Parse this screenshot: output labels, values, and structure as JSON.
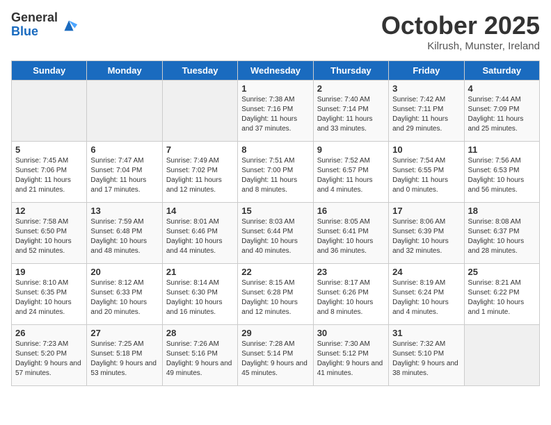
{
  "header": {
    "logo_general": "General",
    "logo_blue": "Blue",
    "month": "October 2025",
    "location": "Kilrush, Munster, Ireland"
  },
  "days_of_week": [
    "Sunday",
    "Monday",
    "Tuesday",
    "Wednesday",
    "Thursday",
    "Friday",
    "Saturday"
  ],
  "weeks": [
    [
      {
        "day": "",
        "info": ""
      },
      {
        "day": "",
        "info": ""
      },
      {
        "day": "",
        "info": ""
      },
      {
        "day": "1",
        "info": "Sunrise: 7:38 AM\nSunset: 7:16 PM\nDaylight: 11 hours and 37 minutes."
      },
      {
        "day": "2",
        "info": "Sunrise: 7:40 AM\nSunset: 7:14 PM\nDaylight: 11 hours and 33 minutes."
      },
      {
        "day": "3",
        "info": "Sunrise: 7:42 AM\nSunset: 7:11 PM\nDaylight: 11 hours and 29 minutes."
      },
      {
        "day": "4",
        "info": "Sunrise: 7:44 AM\nSunset: 7:09 PM\nDaylight: 11 hours and 25 minutes."
      }
    ],
    [
      {
        "day": "5",
        "info": "Sunrise: 7:45 AM\nSunset: 7:06 PM\nDaylight: 11 hours and 21 minutes."
      },
      {
        "day": "6",
        "info": "Sunrise: 7:47 AM\nSunset: 7:04 PM\nDaylight: 11 hours and 17 minutes."
      },
      {
        "day": "7",
        "info": "Sunrise: 7:49 AM\nSunset: 7:02 PM\nDaylight: 11 hours and 12 minutes."
      },
      {
        "day": "8",
        "info": "Sunrise: 7:51 AM\nSunset: 7:00 PM\nDaylight: 11 hours and 8 minutes."
      },
      {
        "day": "9",
        "info": "Sunrise: 7:52 AM\nSunset: 6:57 PM\nDaylight: 11 hours and 4 minutes."
      },
      {
        "day": "10",
        "info": "Sunrise: 7:54 AM\nSunset: 6:55 PM\nDaylight: 11 hours and 0 minutes."
      },
      {
        "day": "11",
        "info": "Sunrise: 7:56 AM\nSunset: 6:53 PM\nDaylight: 10 hours and 56 minutes."
      }
    ],
    [
      {
        "day": "12",
        "info": "Sunrise: 7:58 AM\nSunset: 6:50 PM\nDaylight: 10 hours and 52 minutes."
      },
      {
        "day": "13",
        "info": "Sunrise: 7:59 AM\nSunset: 6:48 PM\nDaylight: 10 hours and 48 minutes."
      },
      {
        "day": "14",
        "info": "Sunrise: 8:01 AM\nSunset: 6:46 PM\nDaylight: 10 hours and 44 minutes."
      },
      {
        "day": "15",
        "info": "Sunrise: 8:03 AM\nSunset: 6:44 PM\nDaylight: 10 hours and 40 minutes."
      },
      {
        "day": "16",
        "info": "Sunrise: 8:05 AM\nSunset: 6:41 PM\nDaylight: 10 hours and 36 minutes."
      },
      {
        "day": "17",
        "info": "Sunrise: 8:06 AM\nSunset: 6:39 PM\nDaylight: 10 hours and 32 minutes."
      },
      {
        "day": "18",
        "info": "Sunrise: 8:08 AM\nSunset: 6:37 PM\nDaylight: 10 hours and 28 minutes."
      }
    ],
    [
      {
        "day": "19",
        "info": "Sunrise: 8:10 AM\nSunset: 6:35 PM\nDaylight: 10 hours and 24 minutes."
      },
      {
        "day": "20",
        "info": "Sunrise: 8:12 AM\nSunset: 6:33 PM\nDaylight: 10 hours and 20 minutes."
      },
      {
        "day": "21",
        "info": "Sunrise: 8:14 AM\nSunset: 6:30 PM\nDaylight: 10 hours and 16 minutes."
      },
      {
        "day": "22",
        "info": "Sunrise: 8:15 AM\nSunset: 6:28 PM\nDaylight: 10 hours and 12 minutes."
      },
      {
        "day": "23",
        "info": "Sunrise: 8:17 AM\nSunset: 6:26 PM\nDaylight: 10 hours and 8 minutes."
      },
      {
        "day": "24",
        "info": "Sunrise: 8:19 AM\nSunset: 6:24 PM\nDaylight: 10 hours and 4 minutes."
      },
      {
        "day": "25",
        "info": "Sunrise: 8:21 AM\nSunset: 6:22 PM\nDaylight: 10 hours and 1 minute."
      }
    ],
    [
      {
        "day": "26",
        "info": "Sunrise: 7:23 AM\nSunset: 5:20 PM\nDaylight: 9 hours and 57 minutes."
      },
      {
        "day": "27",
        "info": "Sunrise: 7:25 AM\nSunset: 5:18 PM\nDaylight: 9 hours and 53 minutes."
      },
      {
        "day": "28",
        "info": "Sunrise: 7:26 AM\nSunset: 5:16 PM\nDaylight: 9 hours and 49 minutes."
      },
      {
        "day": "29",
        "info": "Sunrise: 7:28 AM\nSunset: 5:14 PM\nDaylight: 9 hours and 45 minutes."
      },
      {
        "day": "30",
        "info": "Sunrise: 7:30 AM\nSunset: 5:12 PM\nDaylight: 9 hours and 41 minutes."
      },
      {
        "day": "31",
        "info": "Sunrise: 7:32 AM\nSunset: 5:10 PM\nDaylight: 9 hours and 38 minutes."
      },
      {
        "day": "",
        "info": ""
      }
    ]
  ]
}
